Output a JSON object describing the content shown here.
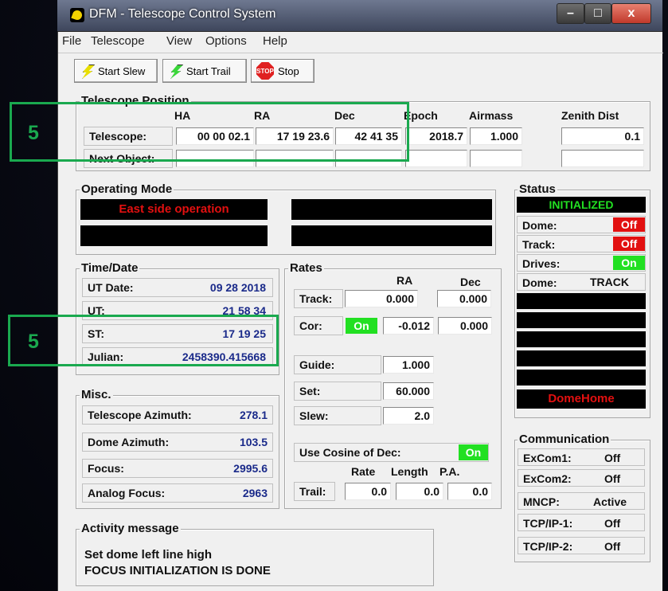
{
  "window": {
    "title": "DFM - Telescope Control System"
  },
  "menu": [
    "File",
    "Telescope",
    "View",
    "Options",
    "Help"
  ],
  "toolbar": {
    "start_slew": "Start Slew",
    "start_trail": "Start Trail",
    "stop": "Stop",
    "stop_icon_text": "STOP"
  },
  "telescope_position": {
    "title": "Telescope Position",
    "headers": {
      "ha": "HA",
      "ra": "RA",
      "dec": "Dec",
      "epoch": "Epoch",
      "airmass": "Airmass",
      "zenith": "Zenith Dist"
    },
    "telescope_label": "Telescope:",
    "telescope": {
      "ha": "00 00 02.1",
      "ra": "17 19 23.6",
      "dec": "42 41 35",
      "epoch": "2018.7",
      "airmass": "1.000",
      "zenith": "0.1"
    },
    "next_label": "Next Object:"
  },
  "operating_mode": {
    "title": "Operating Mode",
    "message": "East side operation"
  },
  "time_date": {
    "title": "Time/Date",
    "rows": [
      {
        "label": "UT Date:",
        "value": "09 28 2018"
      },
      {
        "label": "UT:",
        "value": "21 58 34"
      },
      {
        "label": "ST:",
        "value": "17 19 25"
      },
      {
        "label": "Julian:",
        "value": "2458390.415668"
      }
    ]
  },
  "rates": {
    "title": "Rates",
    "ra_header": "RA",
    "dec_header": "Dec",
    "track_label": "Track:",
    "track_ra": "0.000",
    "track_dec": "0.000",
    "cor_label": "Cor:",
    "cor_state": "On",
    "cor_ra": "-0.012",
    "cor_dec": "0.000",
    "guide_label": "Guide:",
    "guide": "1.000",
    "set_label": "Set:",
    "set": "60.000",
    "slew_label": "Slew:",
    "slew": "2.0",
    "cosine_label": "Use Cosine of Dec:",
    "cosine_state": "On",
    "trail_rate_header": "Rate",
    "trail_length_header": "Length",
    "trail_pa_header": "P.A.",
    "trail_label": "Trail:",
    "trail_rate": "0.0",
    "trail_length": "0.0",
    "trail_pa": "0.0"
  },
  "status": {
    "title": "Status",
    "state": "INITIALIZED",
    "dome_label": "Dome:",
    "dome_state": "Off",
    "track_label": "Track:",
    "track_state": "Off",
    "drives_label": "Drives:",
    "drives_state": "On",
    "dome_mode_label": "Dome:",
    "dome_mode": "TRACK",
    "dome_home": "DomeHome"
  },
  "misc": {
    "title": "Misc.",
    "rows": [
      {
        "label": "Telescope Azimuth:",
        "value": "278.1"
      },
      {
        "label": "Dome Azimuth:",
        "value": "103.5"
      },
      {
        "label": "Focus:",
        "value": "2995.6"
      },
      {
        "label": "Analog Focus:",
        "value": "2963"
      }
    ]
  },
  "communication": {
    "title": "Communication",
    "rows": [
      {
        "label": "ExCom1:",
        "value": "Off"
      },
      {
        "label": "ExCom2:",
        "value": "Off"
      },
      {
        "label": "MNCP:",
        "value": "Active"
      },
      {
        "label": "TCP/IP-1:",
        "value": "Off"
      },
      {
        "label": "TCP/IP-2:",
        "value": "Off"
      }
    ]
  },
  "activity": {
    "title": "Activity message",
    "line1": "Set dome left line high",
    "line2": "FOCUS INITIALIZATION IS DONE"
  },
  "annotations": {
    "top_number": "5",
    "bottom_number": "5",
    "color": "#1aa94f"
  },
  "colors": {
    "status_green": "#22e022",
    "status_red": "#e21010",
    "blue_value": "#1a2a8a"
  }
}
